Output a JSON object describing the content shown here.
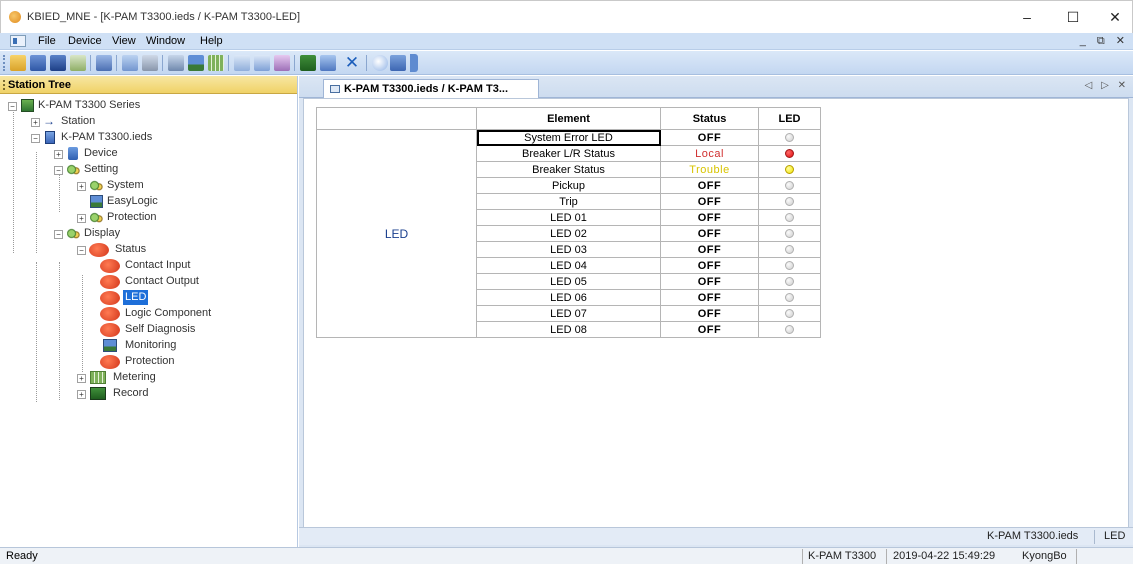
{
  "window": {
    "title": "KBIED_MNE - [K-PAM T3300.ieds / K-PAM T3300-LED]",
    "min_glyph": "–",
    "max_glyph": "☐",
    "close_glyph": "✕"
  },
  "menu": {
    "items": [
      "File",
      "Device",
      "View",
      "Window",
      "Help"
    ],
    "mdi_controls": "_ ⧉ ✕"
  },
  "toolbar": {
    "icons": [
      "open-icon",
      "save-icon",
      "connect-icon",
      "disconnect-icon",
      "compare-icon",
      "download-icon",
      "upload-icon",
      "settings-icon",
      "monitor-icon",
      "table-icon",
      "chart-icon",
      "waveform-icon",
      "tools-icon",
      "device-add-icon",
      "delete-icon",
      "help-icon"
    ]
  },
  "station_tree": {
    "title": "Station Tree",
    "nodes": {
      "series": "K-PAM T3300 Series",
      "station": "Station",
      "ieds": "K-PAM T3300.ieds",
      "device": "Device",
      "setting": "Setting",
      "system": "System",
      "easylogic": "EasyLogic",
      "protection": "Protection",
      "display": "Display",
      "status": "Status",
      "contact_input": "Contact Input",
      "contact_output": "Contact Output",
      "led": "LED",
      "logic_component": "Logic Component",
      "self_diagnosis": "Self Diagnosis",
      "monitoring": "Monitoring",
      "protection2": "Protection",
      "metering": "Metering",
      "record": "Record"
    }
  },
  "document": {
    "tab_label": "K-PAM T3300.ieds / K-PAM T3...",
    "tab_nav": "◁ ▷ ✕",
    "table": {
      "headers": [
        "Element",
        "Status",
        "LED"
      ],
      "group": "LED",
      "rows": [
        {
          "element": "System Error LED",
          "status": "OFF",
          "led": "off"
        },
        {
          "element": "Breaker L/R Status",
          "status": "Local",
          "led": "red"
        },
        {
          "element": "Breaker Status",
          "status": "Trouble",
          "led": "yellow"
        },
        {
          "element": "Pickup",
          "status": "OFF",
          "led": "off"
        },
        {
          "element": "Trip",
          "status": "OFF",
          "led": "off"
        },
        {
          "element": "LED 01",
          "status": "OFF",
          "led": "off"
        },
        {
          "element": "LED 02",
          "status": "OFF",
          "led": "off"
        },
        {
          "element": "LED 03",
          "status": "OFF",
          "led": "off"
        },
        {
          "element": "LED 04",
          "status": "OFF",
          "led": "off"
        },
        {
          "element": "LED 05",
          "status": "OFF",
          "led": "off"
        },
        {
          "element": "LED 06",
          "status": "OFF",
          "led": "off"
        },
        {
          "element": "LED 07",
          "status": "OFF",
          "led": "off"
        },
        {
          "element": "LED 08",
          "status": "OFF",
          "led": "off"
        }
      ]
    },
    "status_cells": [
      "K-PAM T3300.ieds",
      "LED"
    ]
  },
  "statusbar": {
    "ready": "Ready",
    "device": "K-PAM T3300",
    "datetime": "2019-04-22 15:49:29",
    "user": "KyongBo"
  },
  "colors": {
    "local": "#d03030",
    "trouble": "#d8c400",
    "selection": "#1e6fd9"
  }
}
